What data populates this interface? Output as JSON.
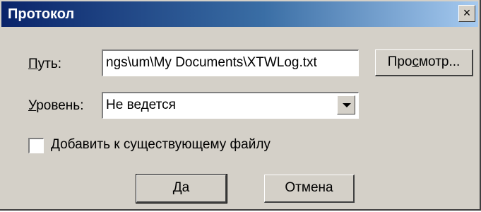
{
  "window": {
    "title": "Протокол",
    "close_glyph": "×"
  },
  "path": {
    "label_accel": "П",
    "label_rest": "уть:",
    "value": "ngs\\um\\My Documents\\XTWLog.txt",
    "browse_before": "Про",
    "browse_accel": "с",
    "browse_after": "мотр..."
  },
  "level": {
    "label_accel": "У",
    "label_rest": "ровень:",
    "value": "Не ведется"
  },
  "append": {
    "checked": false,
    "label_accel": "Д",
    "label_rest": "обавить к существующему файлу"
  },
  "buttons": {
    "ok": "Да",
    "cancel": "Отмена"
  },
  "colors": {
    "face": "#d4d0c8",
    "title_start": "#0a246a",
    "title_end": "#a6caf0"
  }
}
